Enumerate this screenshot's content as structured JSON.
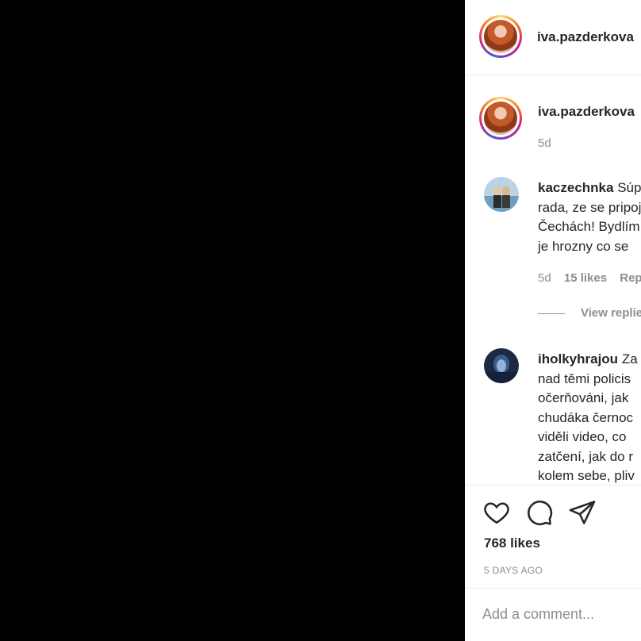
{
  "post": {
    "username": "iva.pazderkova",
    "caption_age": "5d"
  },
  "comments": [
    {
      "username": "kaczechnka",
      "lines": [
        "Súper",
        "rada, ze se pripoj",
        "Čechách! Bydlím",
        "je hrozny co se"
      ],
      "first_line_rest": "Súp",
      "age": "5d",
      "likes": "15 likes",
      "reply": "Reply",
      "view_replies": "View replies"
    },
    {
      "username": "iholkyhrajou",
      "first_line_rest": "Za",
      "lines": [
        "nad těmi policis",
        "očerňováni, jak",
        "chudáka černoc",
        "viděli video, co",
        "zatčení, jak do r",
        "kolem sebe, pliv"
      ]
    }
  ],
  "actions": {
    "likes_total": "768 likes",
    "date": "5 DAYS AGO"
  },
  "comment_box": {
    "placeholder": "Add a comment..."
  },
  "icons": [
    "heart-icon",
    "comment-icon",
    "share-icon"
  ]
}
